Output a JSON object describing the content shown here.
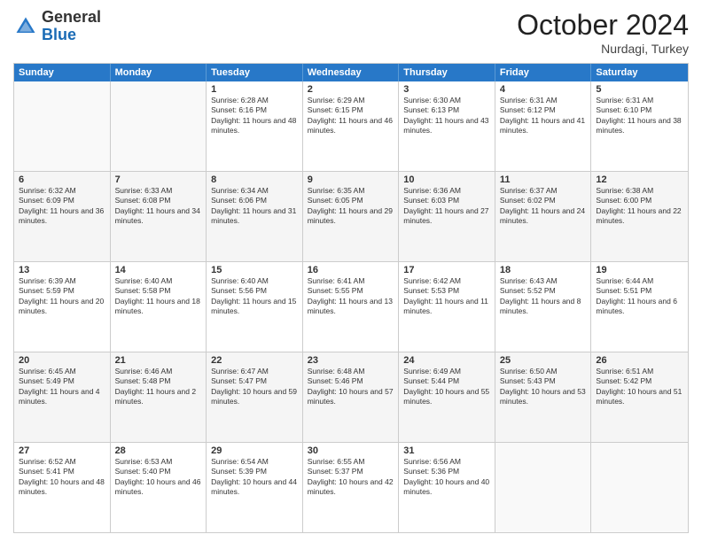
{
  "header": {
    "logo": {
      "line1": "General",
      "line2": "Blue"
    },
    "month": "October 2024",
    "location": "Nurdagi, Turkey"
  },
  "weekdays": [
    "Sunday",
    "Monday",
    "Tuesday",
    "Wednesday",
    "Thursday",
    "Friday",
    "Saturday"
  ],
  "weeks": [
    [
      {
        "day": "",
        "empty": true
      },
      {
        "day": "",
        "empty": true
      },
      {
        "day": "1",
        "sunrise": "Sunrise: 6:28 AM",
        "sunset": "Sunset: 6:16 PM",
        "daylight": "Daylight: 11 hours and 48 minutes."
      },
      {
        "day": "2",
        "sunrise": "Sunrise: 6:29 AM",
        "sunset": "Sunset: 6:15 PM",
        "daylight": "Daylight: 11 hours and 46 minutes."
      },
      {
        "day": "3",
        "sunrise": "Sunrise: 6:30 AM",
        "sunset": "Sunset: 6:13 PM",
        "daylight": "Daylight: 11 hours and 43 minutes."
      },
      {
        "day": "4",
        "sunrise": "Sunrise: 6:31 AM",
        "sunset": "Sunset: 6:12 PM",
        "daylight": "Daylight: 11 hours and 41 minutes."
      },
      {
        "day": "5",
        "sunrise": "Sunrise: 6:31 AM",
        "sunset": "Sunset: 6:10 PM",
        "daylight": "Daylight: 11 hours and 38 minutes."
      }
    ],
    [
      {
        "day": "6",
        "sunrise": "Sunrise: 6:32 AM",
        "sunset": "Sunset: 6:09 PM",
        "daylight": "Daylight: 11 hours and 36 minutes."
      },
      {
        "day": "7",
        "sunrise": "Sunrise: 6:33 AM",
        "sunset": "Sunset: 6:08 PM",
        "daylight": "Daylight: 11 hours and 34 minutes."
      },
      {
        "day": "8",
        "sunrise": "Sunrise: 6:34 AM",
        "sunset": "Sunset: 6:06 PM",
        "daylight": "Daylight: 11 hours and 31 minutes."
      },
      {
        "day": "9",
        "sunrise": "Sunrise: 6:35 AM",
        "sunset": "Sunset: 6:05 PM",
        "daylight": "Daylight: 11 hours and 29 minutes."
      },
      {
        "day": "10",
        "sunrise": "Sunrise: 6:36 AM",
        "sunset": "Sunset: 6:03 PM",
        "daylight": "Daylight: 11 hours and 27 minutes."
      },
      {
        "day": "11",
        "sunrise": "Sunrise: 6:37 AM",
        "sunset": "Sunset: 6:02 PM",
        "daylight": "Daylight: 11 hours and 24 minutes."
      },
      {
        "day": "12",
        "sunrise": "Sunrise: 6:38 AM",
        "sunset": "Sunset: 6:00 PM",
        "daylight": "Daylight: 11 hours and 22 minutes."
      }
    ],
    [
      {
        "day": "13",
        "sunrise": "Sunrise: 6:39 AM",
        "sunset": "Sunset: 5:59 PM",
        "daylight": "Daylight: 11 hours and 20 minutes."
      },
      {
        "day": "14",
        "sunrise": "Sunrise: 6:40 AM",
        "sunset": "Sunset: 5:58 PM",
        "daylight": "Daylight: 11 hours and 18 minutes."
      },
      {
        "day": "15",
        "sunrise": "Sunrise: 6:40 AM",
        "sunset": "Sunset: 5:56 PM",
        "daylight": "Daylight: 11 hours and 15 minutes."
      },
      {
        "day": "16",
        "sunrise": "Sunrise: 6:41 AM",
        "sunset": "Sunset: 5:55 PM",
        "daylight": "Daylight: 11 hours and 13 minutes."
      },
      {
        "day": "17",
        "sunrise": "Sunrise: 6:42 AM",
        "sunset": "Sunset: 5:53 PM",
        "daylight": "Daylight: 11 hours and 11 minutes."
      },
      {
        "day": "18",
        "sunrise": "Sunrise: 6:43 AM",
        "sunset": "Sunset: 5:52 PM",
        "daylight": "Daylight: 11 hours and 8 minutes."
      },
      {
        "day": "19",
        "sunrise": "Sunrise: 6:44 AM",
        "sunset": "Sunset: 5:51 PM",
        "daylight": "Daylight: 11 hours and 6 minutes."
      }
    ],
    [
      {
        "day": "20",
        "sunrise": "Sunrise: 6:45 AM",
        "sunset": "Sunset: 5:49 PM",
        "daylight": "Daylight: 11 hours and 4 minutes."
      },
      {
        "day": "21",
        "sunrise": "Sunrise: 6:46 AM",
        "sunset": "Sunset: 5:48 PM",
        "daylight": "Daylight: 11 hours and 2 minutes."
      },
      {
        "day": "22",
        "sunrise": "Sunrise: 6:47 AM",
        "sunset": "Sunset: 5:47 PM",
        "daylight": "Daylight: 10 hours and 59 minutes."
      },
      {
        "day": "23",
        "sunrise": "Sunrise: 6:48 AM",
        "sunset": "Sunset: 5:46 PM",
        "daylight": "Daylight: 10 hours and 57 minutes."
      },
      {
        "day": "24",
        "sunrise": "Sunrise: 6:49 AM",
        "sunset": "Sunset: 5:44 PM",
        "daylight": "Daylight: 10 hours and 55 minutes."
      },
      {
        "day": "25",
        "sunrise": "Sunrise: 6:50 AM",
        "sunset": "Sunset: 5:43 PM",
        "daylight": "Daylight: 10 hours and 53 minutes."
      },
      {
        "day": "26",
        "sunrise": "Sunrise: 6:51 AM",
        "sunset": "Sunset: 5:42 PM",
        "daylight": "Daylight: 10 hours and 51 minutes."
      }
    ],
    [
      {
        "day": "27",
        "sunrise": "Sunrise: 6:52 AM",
        "sunset": "Sunset: 5:41 PM",
        "daylight": "Daylight: 10 hours and 48 minutes."
      },
      {
        "day": "28",
        "sunrise": "Sunrise: 6:53 AM",
        "sunset": "Sunset: 5:40 PM",
        "daylight": "Daylight: 10 hours and 46 minutes."
      },
      {
        "day": "29",
        "sunrise": "Sunrise: 6:54 AM",
        "sunset": "Sunset: 5:39 PM",
        "daylight": "Daylight: 10 hours and 44 minutes."
      },
      {
        "day": "30",
        "sunrise": "Sunrise: 6:55 AM",
        "sunset": "Sunset: 5:37 PM",
        "daylight": "Daylight: 10 hours and 42 minutes."
      },
      {
        "day": "31",
        "sunrise": "Sunrise: 6:56 AM",
        "sunset": "Sunset: 5:36 PM",
        "daylight": "Daylight: 10 hours and 40 minutes."
      },
      {
        "day": "",
        "empty": true
      },
      {
        "day": "",
        "empty": true
      }
    ]
  ]
}
